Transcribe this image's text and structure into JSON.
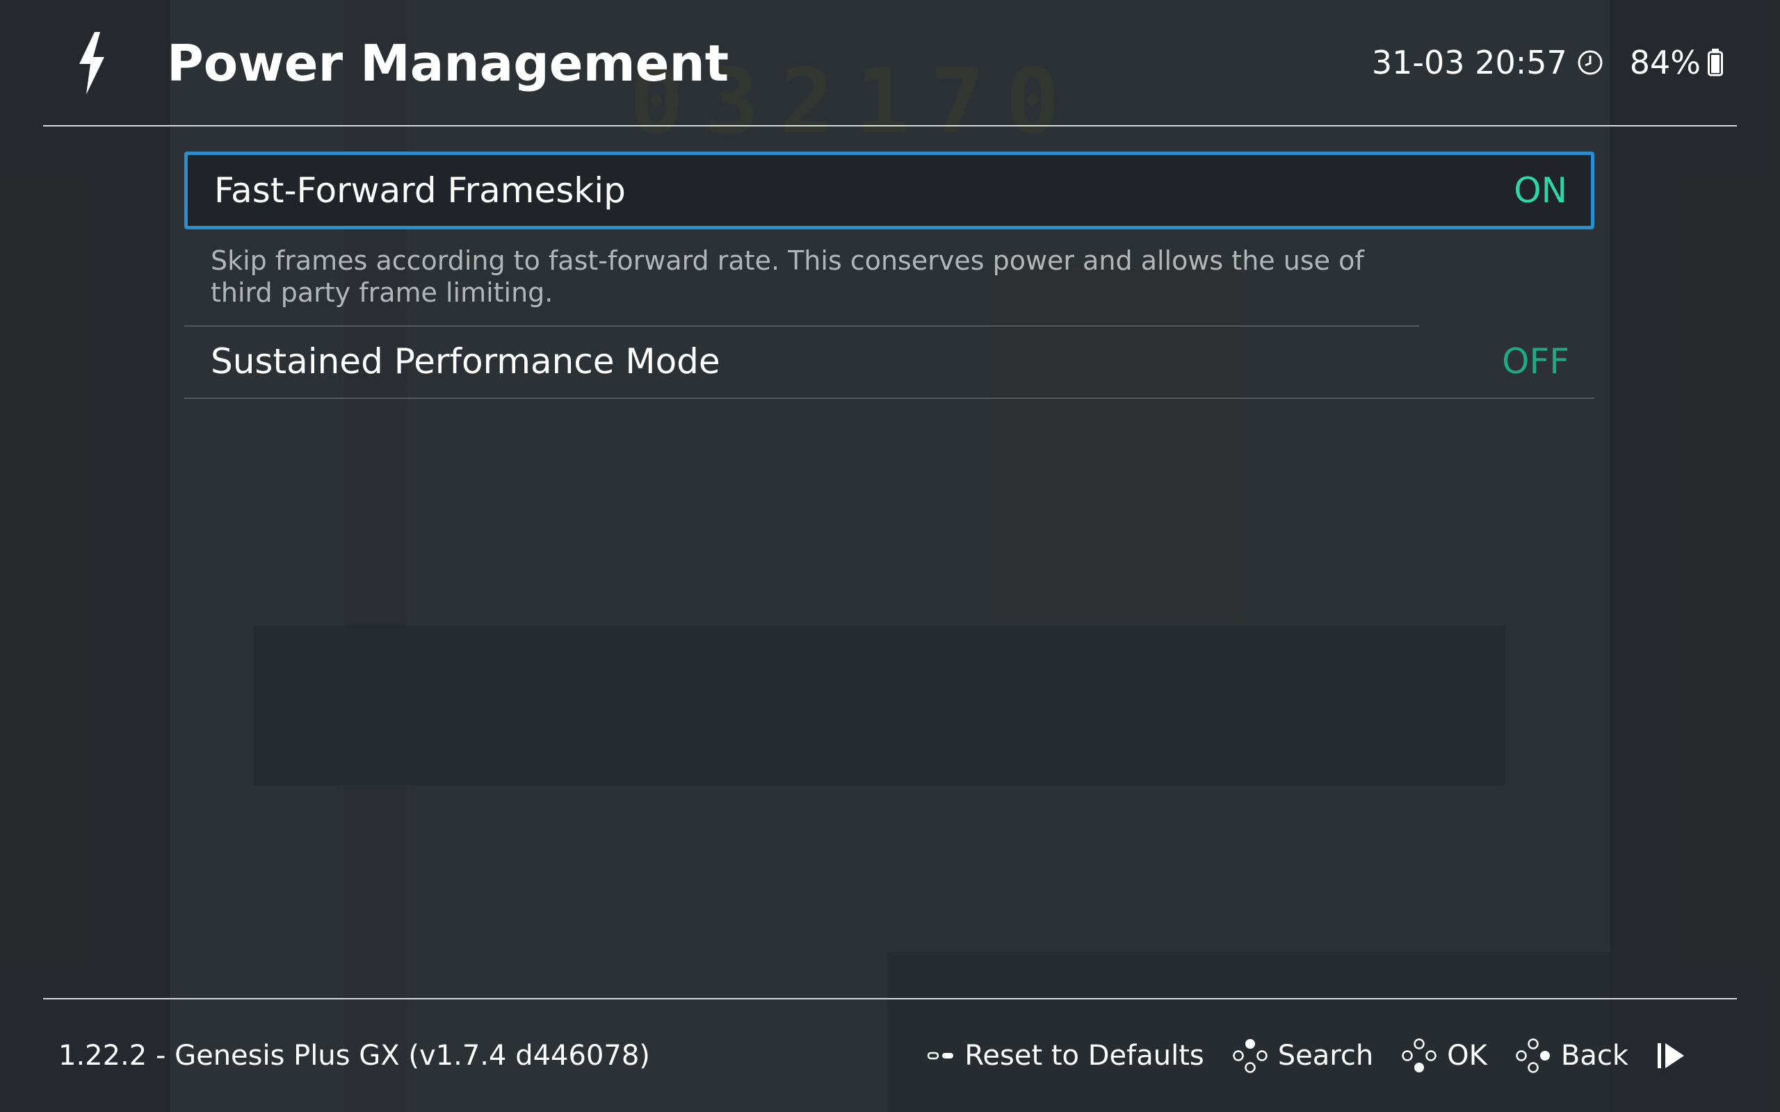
{
  "header": {
    "title": "Power Management",
    "datetime": "31-03 20:57",
    "battery": "84%"
  },
  "settings": {
    "items": [
      {
        "label": "Fast-Forward Frameskip",
        "value": "ON",
        "description": "Skip frames according to fast-forward rate. This conserves power and allows the use of third party frame limiting."
      },
      {
        "label": "Sustained Performance Mode",
        "value": "OFF"
      }
    ]
  },
  "background": {
    "score": "032170"
  },
  "footer": {
    "version": "1.22.2 - Genesis Plus GX (v1.7.4 d446078)",
    "hints": {
      "reset": "Reset to Defaults",
      "search": "Search",
      "ok": "OK",
      "back": "Back"
    }
  },
  "colors": {
    "accent_border": "#2a8fd0",
    "value_on": "#2fd7a8",
    "value_off": "#1fa980"
  },
  "icons": [
    "bolt-icon",
    "clock-icon",
    "battery-icon",
    "select-button-icon",
    "button-diamond-icon",
    "resume-icon"
  ]
}
